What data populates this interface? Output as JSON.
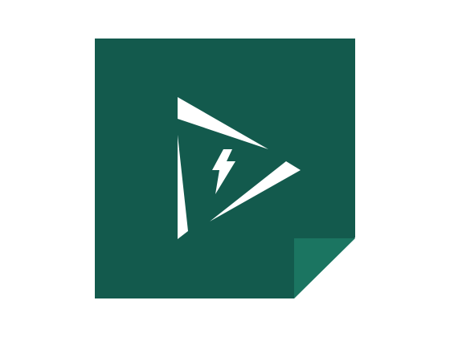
{
  "app_icon": {
    "icon_name": "dynamics-365-sales-play-bolt-icon",
    "colors": {
      "background": "#ffffff",
      "tile": "#135a4d",
      "fold": "#1b7561",
      "mark": "#ffffff"
    }
  }
}
